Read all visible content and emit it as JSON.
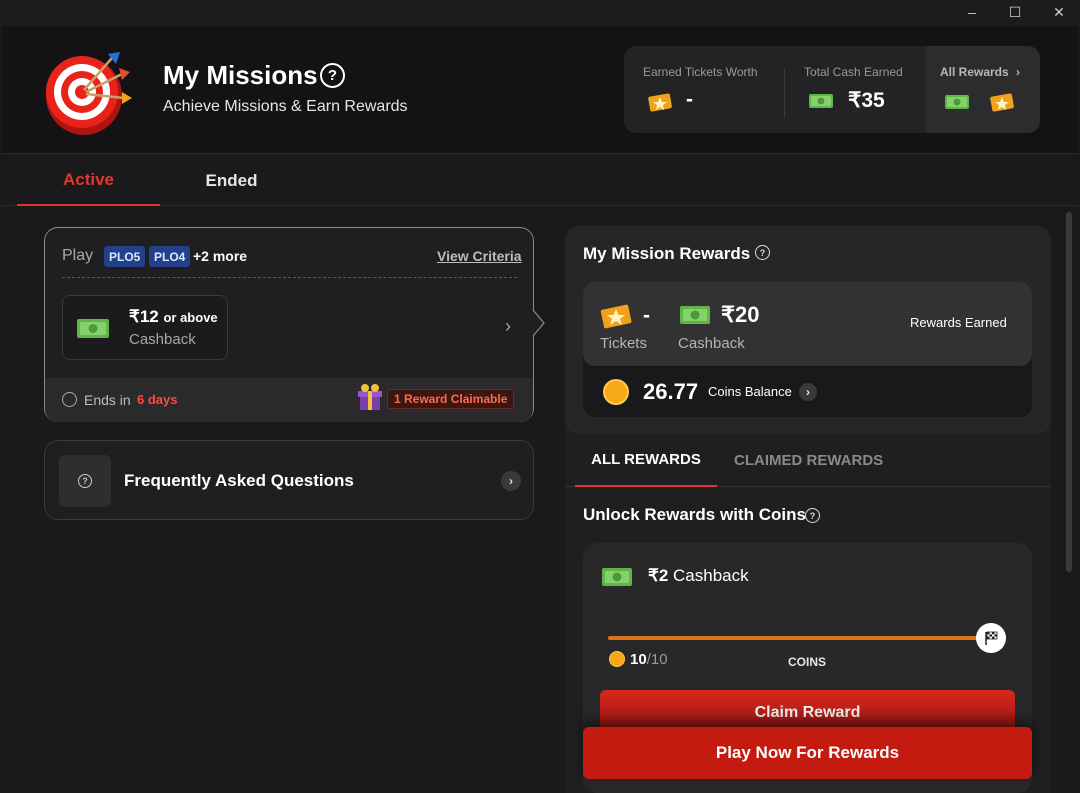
{
  "window": {
    "minimize": "–",
    "maximize": "☐",
    "close": "✕"
  },
  "header": {
    "title": "My Missions",
    "help": "?",
    "subtitle": "Achieve Missions & Earn Rewards",
    "logo_icon": "target-bullseye-icon"
  },
  "stats": {
    "earned_tickets_label": "Earned Tickets Worth",
    "earned_tickets_value": "-",
    "total_cash_label": "Total Cash Earned",
    "total_cash_value": "₹35",
    "all_rewards_label": "All Rewards",
    "all_rewards_chevron": "›"
  },
  "tabs": {
    "active": "Active",
    "ended": "Ended"
  },
  "mission": {
    "play_label": "Play",
    "chips": [
      "PLO5",
      "PLO4"
    ],
    "more": "+2 more",
    "view_criteria": "View Criteria",
    "reward_amount": "₹12",
    "reward_qualifier": "or above",
    "reward_type": "Cashback",
    "chevron": "›",
    "ends_label": "Ends in",
    "ends_value": "6 days",
    "claimable": "1 Reward Claimable"
  },
  "faq": {
    "label": "Frequently Asked Questions",
    "icon": "?",
    "chevron": "›"
  },
  "rewards_panel": {
    "title": "My Mission Rewards",
    "help": "?",
    "tickets_value": "-",
    "tickets_label": "Tickets",
    "cashback_value": "₹20",
    "cashback_label": "Cashback",
    "rewards_earned": "Rewards Earned",
    "coins_value": "26.77",
    "coins_label": "Coins Balance",
    "coins_chevron": "›",
    "tab_all": "ALL REWARDS",
    "tab_claimed": "CLAIMED REWARDS",
    "unlock_title": "Unlock Rewards with Coins",
    "unlock_help": "?",
    "card": {
      "amount": "₹2",
      "type": "Cashback",
      "progress_current": "10",
      "progress_total": "/10",
      "progress_fraction": 1.0,
      "coins_label": "COINS",
      "claim_button": "Claim Reward"
    }
  },
  "play_button": "Play Now For Rewards",
  "colors": {
    "accent": "#e0362c",
    "coin": "#f6a81a",
    "progress": "#d9731a",
    "chip": "#22418a"
  }
}
